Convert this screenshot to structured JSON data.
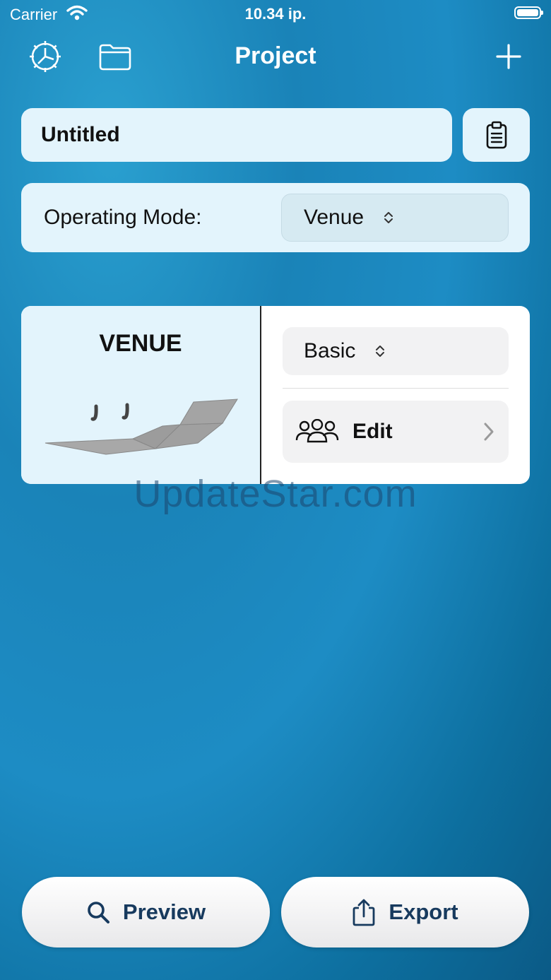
{
  "status_bar": {
    "carrier": "Carrier",
    "time": "10.34 ip."
  },
  "nav": {
    "title": "Project",
    "icons": [
      "settings-icon",
      "folder-icon",
      "plus-icon"
    ]
  },
  "project": {
    "name": "Untitled",
    "clipboard_icon": "clipboard-icon"
  },
  "operating_mode": {
    "label": "Operating Mode:",
    "value": "Venue"
  },
  "venue_card": {
    "title": "VENUE",
    "preset": "Basic",
    "edit_label": "Edit",
    "edit_icon": "people-icon"
  },
  "watermark": "UpdateStar.com",
  "bottom": {
    "preview_label": "Preview",
    "export_label": "Export",
    "icons": [
      "search-icon",
      "share-icon"
    ]
  },
  "colors": {
    "card": "#e3f4fc",
    "button_text": "#173a5e"
  }
}
